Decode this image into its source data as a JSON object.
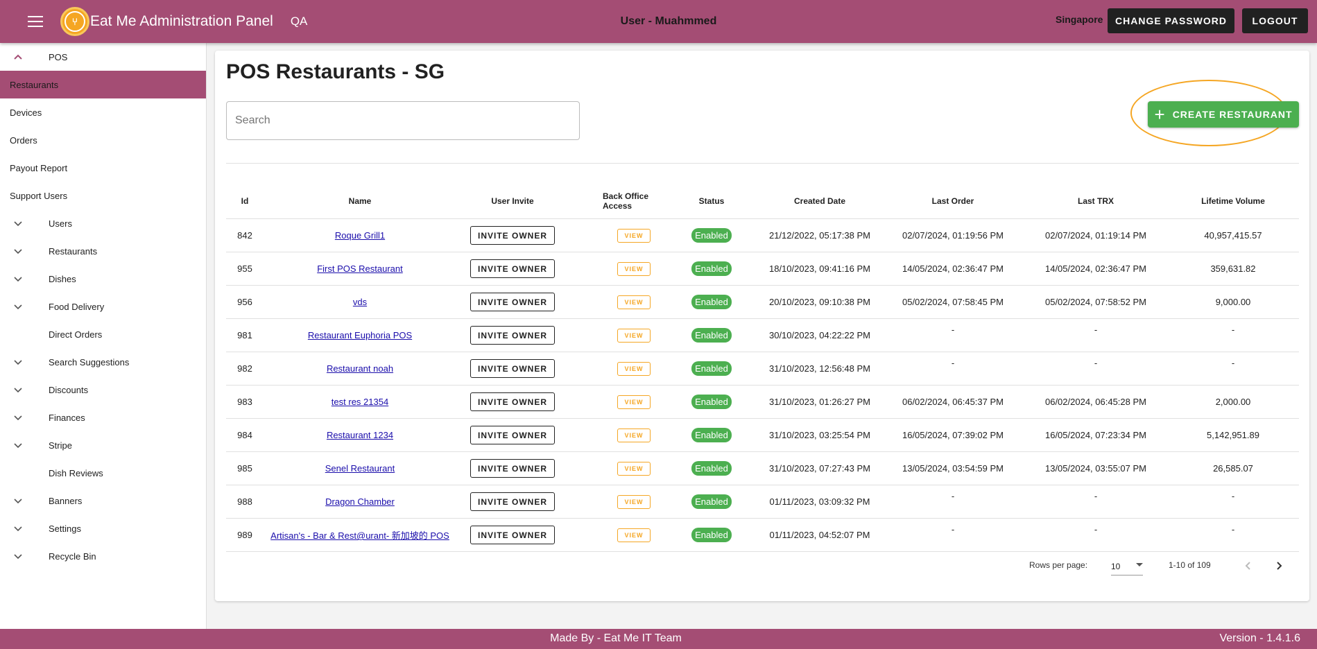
{
  "header": {
    "app_title": "Eat Me Administration Panel",
    "environment": "QA",
    "user": "User - Muahmmed",
    "region": "Singapore",
    "change_password": "CHANGE PASSWORD",
    "logout": "LOGOUT"
  },
  "sidebar": {
    "items": [
      {
        "label": "POS",
        "chevron": "up"
      },
      {
        "label": "Restaurants",
        "active": true
      },
      {
        "label": "Devices"
      },
      {
        "label": "Orders"
      },
      {
        "label": "Payout Report"
      },
      {
        "label": "Support Users"
      },
      {
        "label": "Users",
        "chevron": "down"
      },
      {
        "label": "Restaurants",
        "chevron": "down"
      },
      {
        "label": "Dishes",
        "chevron": "down"
      },
      {
        "label": "Food Delivery",
        "chevron": "down"
      },
      {
        "label": "Direct Orders"
      },
      {
        "label": "Search Suggestions",
        "chevron": "down"
      },
      {
        "label": "Discounts",
        "chevron": "down"
      },
      {
        "label": "Finances",
        "chevron": "down"
      },
      {
        "label": "Stripe",
        "chevron": "down"
      },
      {
        "label": "Dish Reviews"
      },
      {
        "label": "Banners",
        "chevron": "down"
      },
      {
        "label": "Settings",
        "chevron": "down"
      },
      {
        "label": "Recycle Bin",
        "chevron": "down"
      }
    ]
  },
  "main": {
    "title": "POS Restaurants - SG",
    "search_placeholder": "Search",
    "create_button": "CREATE RESTAURANT",
    "table": {
      "headers": {
        "id": "Id",
        "name": "Name",
        "user_invite": "User Invite",
        "back_office": "Back Office Access",
        "status": "Status",
        "created": "Created Date",
        "last_order": "Last Order",
        "last_trx": "Last TRX",
        "volume": "Lifetime Volume"
      },
      "invite_label": "INVITE OWNER",
      "view_label": "VIEW",
      "rows": [
        {
          "id": "842",
          "name": "Roque Grill1",
          "status": "Enabled",
          "created": "21/12/2022, 05:17:38 PM",
          "last_order": "02/07/2024, 01:19:56 PM",
          "last_trx": "02/07/2024, 01:19:14 PM",
          "volume": "40,957,415.57"
        },
        {
          "id": "955",
          "name": "First POS Restaurant",
          "status": "Enabled",
          "created": "18/10/2023, 09:41:16 PM",
          "last_order": "14/05/2024, 02:36:47 PM",
          "last_trx": "14/05/2024, 02:36:47 PM",
          "volume": "359,631.82"
        },
        {
          "id": "956",
          "name": "vds",
          "status": "Enabled",
          "created": "20/10/2023, 09:10:38 PM",
          "last_order": "05/02/2024, 07:58:45 PM",
          "last_trx": "05/02/2024, 07:58:52 PM",
          "volume": "9,000.00"
        },
        {
          "id": "981",
          "name": "Restaurant Euphoria POS",
          "status": "Enabled",
          "created": "30/10/2023, 04:22:22 PM",
          "last_order": "-",
          "last_trx": "-",
          "volume": "-"
        },
        {
          "id": "982",
          "name": "Restaurant noah",
          "status": "Enabled",
          "created": "31/10/2023, 12:56:48 PM",
          "last_order": "-",
          "last_trx": "-",
          "volume": "-"
        },
        {
          "id": "983",
          "name": "test res 21354",
          "status": "Enabled",
          "created": "31/10/2023, 01:26:27 PM",
          "last_order": "06/02/2024, 06:45:37 PM",
          "last_trx": "06/02/2024, 06:45:28 PM",
          "volume": "2,000.00"
        },
        {
          "id": "984",
          "name": "Restaurant 1234",
          "status": "Enabled",
          "created": "31/10/2023, 03:25:54 PM",
          "last_order": "16/05/2024, 07:39:02 PM",
          "last_trx": "16/05/2024, 07:23:34 PM",
          "volume": "5,142,951.89"
        },
        {
          "id": "985",
          "name": "Senel Restaurant",
          "status": "Enabled",
          "created": "31/10/2023, 07:27:43 PM",
          "last_order": "13/05/2024, 03:54:59 PM",
          "last_trx": "13/05/2024, 03:55:07 PM",
          "volume": "26,585.07"
        },
        {
          "id": "988",
          "name": "Dragon Chamber",
          "status": "Enabled",
          "created": "01/11/2023, 03:09:32 PM",
          "last_order": "-",
          "last_trx": "-",
          "volume": "-"
        },
        {
          "id": "989",
          "name": "Artisan's - Bar & Rest@urant- 新加坡的 POS",
          "status": "Enabled",
          "created": "01/11/2023, 04:52:07 PM",
          "last_order": "-",
          "last_trx": "-",
          "volume": "-"
        }
      ]
    },
    "pagination": {
      "rows_per_page_label": "Rows per page:",
      "rows_per_page": "10",
      "range": "1-10 of 109"
    }
  },
  "footer": {
    "made_by": "Made By - Eat Me IT Team",
    "version": "Version - 1.4.1.6"
  },
  "colors": {
    "brand": "#a44d74",
    "accent": "#f5a623",
    "success": "#4caf50"
  }
}
